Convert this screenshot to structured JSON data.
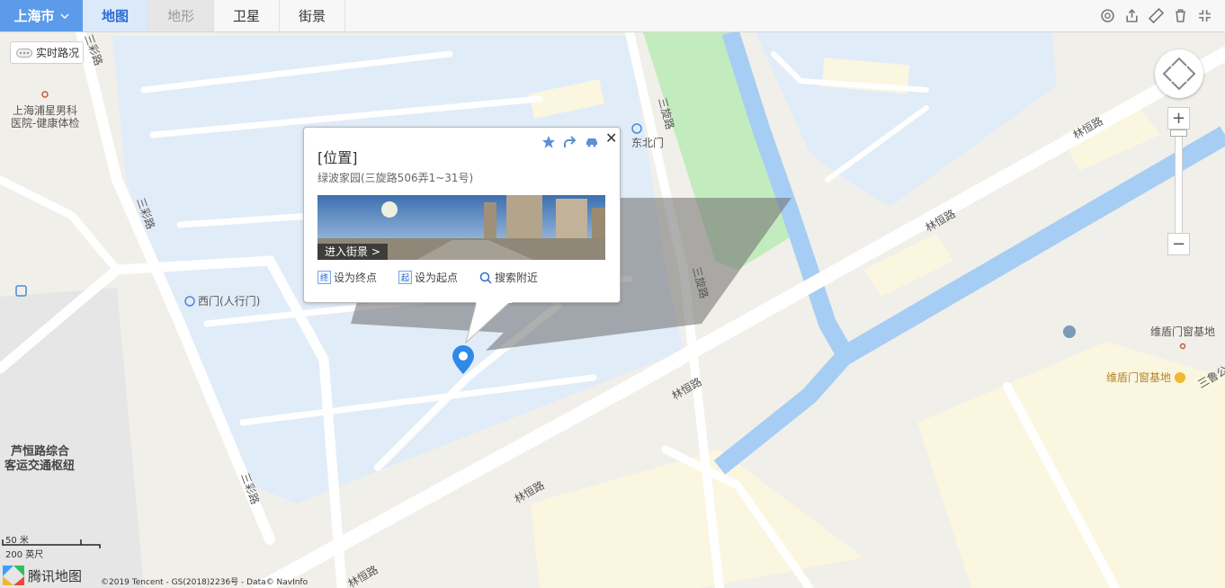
{
  "toolbar": {
    "city": "上海市",
    "tabs": [
      {
        "label": "地图",
        "state": "active"
      },
      {
        "label": "地形",
        "state": "disabled"
      },
      {
        "label": "卫星",
        "state": "normal"
      },
      {
        "label": "街景",
        "state": "normal"
      }
    ],
    "tools": [
      "search-circle-icon",
      "share-icon",
      "ruler-icon",
      "trash-icon",
      "fullscreen-icon"
    ]
  },
  "traffic": {
    "label": "实时路况"
  },
  "popup": {
    "title": "[位置]",
    "address": "绿波家园(三旋路506弄1~31号)",
    "streetview_label": "进入街景 >",
    "actions": [
      {
        "badge": "终",
        "label": "设为终点"
      },
      {
        "badge": "起",
        "label": "设为起点"
      },
      {
        "badge": "",
        "label": "搜索附近"
      }
    ],
    "icons": [
      "star-icon",
      "share-arrow-icon",
      "car-icon"
    ],
    "close": "✕"
  },
  "map_labels": {
    "hospital": "上海浦星男科医院-健康体检",
    "hospital_line1": "上海浦星男科",
    "hospital_line2": "医院-健康体检",
    "east_north_gate": "东北门",
    "west_gate": "西门(人行门)",
    "sanxuan_road": "三旋路",
    "sancai_road": "三彩路",
    "linheng_road": "林恒路",
    "weidun_1": "维盾门窗基地",
    "weidun_2": "维盾门窗基地",
    "sanlu": "三鲁公",
    "luheng_line1": "芦恒路综合",
    "luheng_line2": "客运交通枢纽"
  },
  "scale": {
    "top": "50 米",
    "bottom": "200 英尺"
  },
  "logo": {
    "text": "腾讯地图"
  },
  "copyright": "©2019 Tencent - GS(2018)2236号 - Data© NavInfo",
  "colors": {
    "accent": "#5b9bea",
    "water": "#a6cdf4",
    "green": "#c3ecbe",
    "campus": "#e1ecf9",
    "building": "#faf6e0"
  }
}
